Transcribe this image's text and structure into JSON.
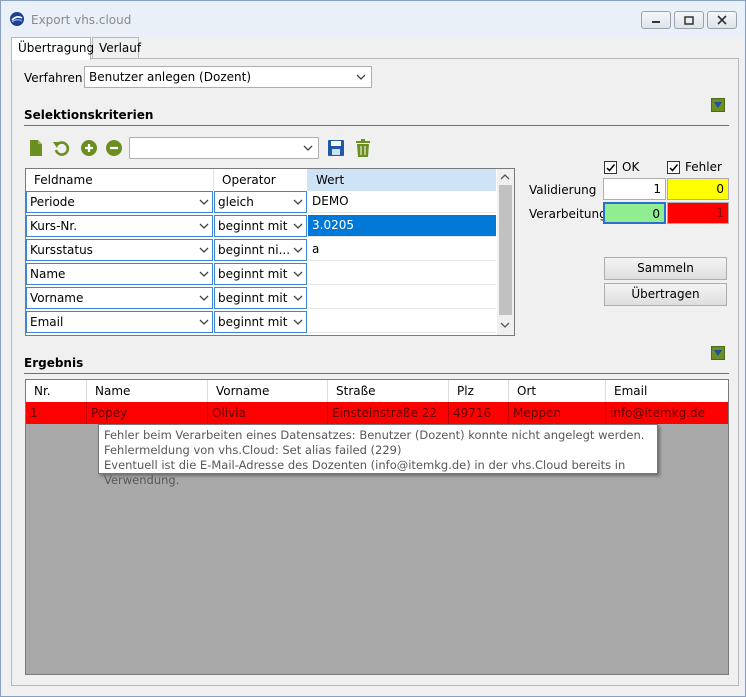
{
  "window": {
    "title": "Export vhs.cloud"
  },
  "tabs": [
    {
      "label": "Übertragung"
    },
    {
      "label": "Verlauf"
    }
  ],
  "verfahren": {
    "label": "Verfahren",
    "value": "Benutzer anlegen (Dozent)"
  },
  "selektion": {
    "title": "Selektionskriterien",
    "toolbar_combo_value": "",
    "columns": [
      "Feldname",
      "Operator",
      "Wert"
    ],
    "rows": [
      {
        "feld": "Periode",
        "operator": "gleich",
        "wert": "DEMO",
        "selected": false
      },
      {
        "feld": "Kurs-Nr.",
        "operator": "beginnt mit",
        "wert": "3.0205",
        "selected": true
      },
      {
        "feld": "Kursstatus",
        "operator": "beginnt ni...",
        "wert": "a",
        "selected": false
      },
      {
        "feld": "Name",
        "operator": "beginnt mit",
        "wert": "",
        "selected": false
      },
      {
        "feld": "Vorname",
        "operator": "beginnt mit",
        "wert": "",
        "selected": false
      },
      {
        "feld": "Email",
        "operator": "beginnt mit",
        "wert": "",
        "selected": false
      }
    ]
  },
  "status": {
    "ok_label": "OK",
    "fehler_label": "Fehler",
    "ok_checked": true,
    "fehler_checked": true,
    "validierung_label": "Validierung",
    "validierung_ok": "1",
    "validierung_fehler": "0",
    "verarbeitung_label": "Verarbeitung",
    "verarbeitung_ok": "0",
    "verarbeitung_fehler": "1",
    "colors": {
      "ok_bg": "#90ee90",
      "warn_bg": "#ffff00",
      "error_bg": "#ff0000"
    }
  },
  "buttons": {
    "sammeln": "Sammeln",
    "uebertragen": "Übertragen"
  },
  "ergebnis": {
    "title": "Ergebnis",
    "columns": [
      "Nr.",
      "Name",
      "Vorname",
      "Straße",
      "Plz",
      "Ort",
      "Email"
    ],
    "rows": [
      {
        "nr": "1",
        "name": "Popey",
        "vorname": "Olivia",
        "strasse": "Einsteinstraße 22",
        "plz": "49716",
        "ort": "Meppen",
        "email": "info@itemkg.de"
      }
    ],
    "row_color": "#ff0000"
  },
  "tooltip": {
    "line1": "Fehler beim Verarbeiten eines Datensatzes: Benutzer (Dozent) konnte nicht angelegt werden.",
    "line2": "Fehlermeldung von vhs.Cloud: Set alias failed (229)",
    "line3": "Eventuell ist die E-Mail-Adresse des Dozenten (info@itemkg.de) in der vhs.Cloud bereits in Verwendung."
  },
  "icons": [
    "app-icon",
    "minimize-icon",
    "maximize-icon",
    "close-icon",
    "new-icon",
    "undo-icon",
    "add-icon",
    "remove-icon",
    "save-icon",
    "delete-icon",
    "collapse-icon",
    "chevron-down-icon"
  ]
}
